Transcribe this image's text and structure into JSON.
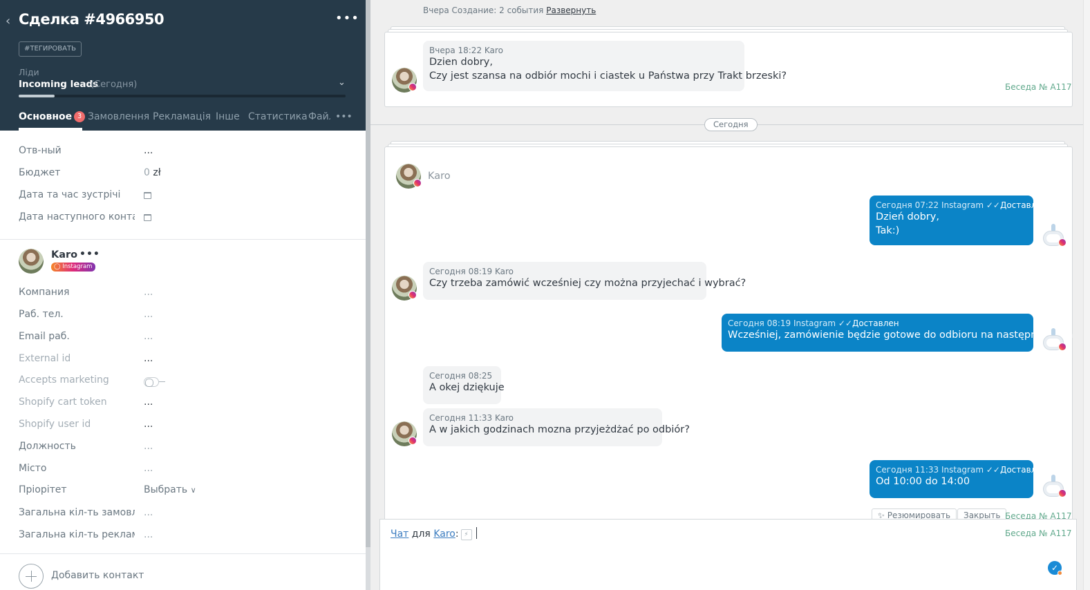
{
  "deal": {
    "title": "Сделка #4966950",
    "tag_button": "#ТЕГИРОВАТЬ",
    "pipeline_label": "Ліди",
    "stage": "Incoming leads",
    "stage_date": "(Сегодня)",
    "stage_progress": 0.11
  },
  "tabs": [
    {
      "label": "Основное",
      "badge": "3"
    },
    {
      "label": "Замовлення"
    },
    {
      "label": "Рекламація"
    },
    {
      "label": "Інше"
    },
    {
      "label": "Статистика"
    },
    {
      "label": "Файл"
    }
  ],
  "fields": [
    {
      "label": "Отв-ный",
      "value": "..."
    },
    {
      "label": "Бюджет",
      "value_num": "0",
      "value_unit": "zł"
    },
    {
      "label": "Дата та час зустрічі"
    },
    {
      "label": "Дата наступного контакту"
    }
  ],
  "contact": {
    "name": "Karo",
    "more": "•••",
    "source_badge": "Instagram",
    "fields": [
      {
        "label": "Компания",
        "value": "..."
      },
      {
        "label": "Раб. тел.",
        "value": "..."
      },
      {
        "label": "Email раб.",
        "value": "..."
      },
      {
        "label": "External id",
        "value": "..."
      },
      {
        "label": "Accepts marketing",
        "value": "off"
      },
      {
        "label": "Shopify cart token",
        "value": "..."
      },
      {
        "label": "Shopify user id",
        "value": "..."
      },
      {
        "label": "Должность",
        "value": "..."
      },
      {
        "label": "Місто",
        "value": "..."
      },
      {
        "label": "Пріорітет",
        "value": "Выбрать"
      },
      {
        "label": "Загальна кіл-ть замовлень",
        "value": "..."
      },
      {
        "label": "Загальна кіл-ть рекламацій",
        "value": "..."
      }
    ],
    "add_contact": "Добавить контакт"
  },
  "history": {
    "text": "Вчера Создание: 2 события",
    "expand_link": "Развернуть"
  },
  "day_separator": "Сегодня",
  "yesterday_message": {
    "meta": "Вчера 18:22 Karo",
    "lines": [
      "Dzien dobry,",
      "Czy jest szansa na odbiór mochi i ciastek u Państwa przy Trakt brzeski?"
    ],
    "conversation": "Беседа № A117"
  },
  "today_header_name": "Karo",
  "messages": [
    {
      "dir": "out",
      "meta": "Сегодня 07:22 Instagram",
      "status": "Доставлен",
      "lines": [
        "Dzień dobry,",
        "Tak:)"
      ]
    },
    {
      "dir": "in",
      "meta": "Сегодня 08:19 Karo",
      "lines": [
        "Czy trzeba zamówić wcześniej czy można przyjechać i wybrać?"
      ]
    },
    {
      "dir": "out",
      "meta": "Сегодня 08:19 Instagram",
      "status": "Доставлен",
      "lines": [
        "Wcześniej, zamówienie będzie gotowe do odbioru na następny dzień"
      ]
    },
    {
      "dir": "in",
      "meta": "Сегодня 08:25",
      "lines": [
        "A okej dziękuje"
      ]
    },
    {
      "dir": "in",
      "meta": "Сегодня 11:33 Karo",
      "lines": [
        "A w jakich godzinach mozna przyjeżdżać po odbiór?"
      ]
    },
    {
      "dir": "out",
      "meta": "Сегодня 11:33 Instagram",
      "status": "Доставлен",
      "lines": [
        "Od 10:00 do 14:00"
      ]
    }
  ],
  "chat_actions": {
    "summarize": "Резюмировать",
    "close": "Закрыть",
    "conversation": "Беседа № A117"
  },
  "composer": {
    "chat_link": "Чат",
    "for_text": "для",
    "contact_link": "Karo",
    "colon": ":",
    "conversation": "Беседа № A117"
  },
  "icons": {
    "back": "chevron-left-icon",
    "more": "ellipsis-icon",
    "calendar": "calendar-icon",
    "instagram": "instagram-icon",
    "delivered": "double-check-icon",
    "send": "send-check-icon"
  },
  "colors": {
    "header_bg": "#263a49",
    "outgoing_bubble": "#0b84c7",
    "incoming_bubble": "#f2f3f4",
    "badge": "#f06c6c",
    "conversation_link": "#5fa88b"
  }
}
